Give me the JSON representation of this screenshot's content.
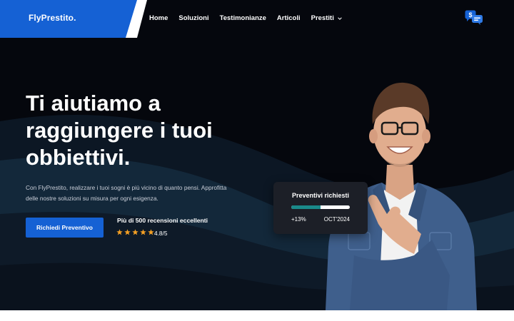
{
  "brand": {
    "name": "FlyPrestito.",
    "color": "#1561d4"
  },
  "nav": {
    "items": [
      {
        "label": "Home"
      },
      {
        "label": "Soluzioni"
      },
      {
        "label": "Testimonianze"
      },
      {
        "label": "Articoli"
      },
      {
        "label": "Prestiti",
        "has_dropdown": true
      }
    ]
  },
  "header_icon": "chat-bubbles-icon",
  "hero": {
    "headline": "Ti aiutiamo a raggiungere i tuoi obbiettivi.",
    "subtext": "Con FlyPrestito, realizzare i tuoi sogni è più vicino di quanto pensi. Approfitta delle nostre soluzioni su misura per ogni esigenza.",
    "cta_label": "Richiedi Preventivo",
    "reviews_title": "Più di 500 recensioni eccellenti",
    "rating_text": "4.8/5",
    "stars": 5
  },
  "card": {
    "title": "Preventivi richiesti",
    "progress": 0.5,
    "left_text": "+13%",
    "right_text": "OCT'2024"
  },
  "colors": {
    "background": "#05070d",
    "accent": "#1561d4",
    "star": "#f4a024",
    "progress_fill": "#1a8a8a"
  }
}
